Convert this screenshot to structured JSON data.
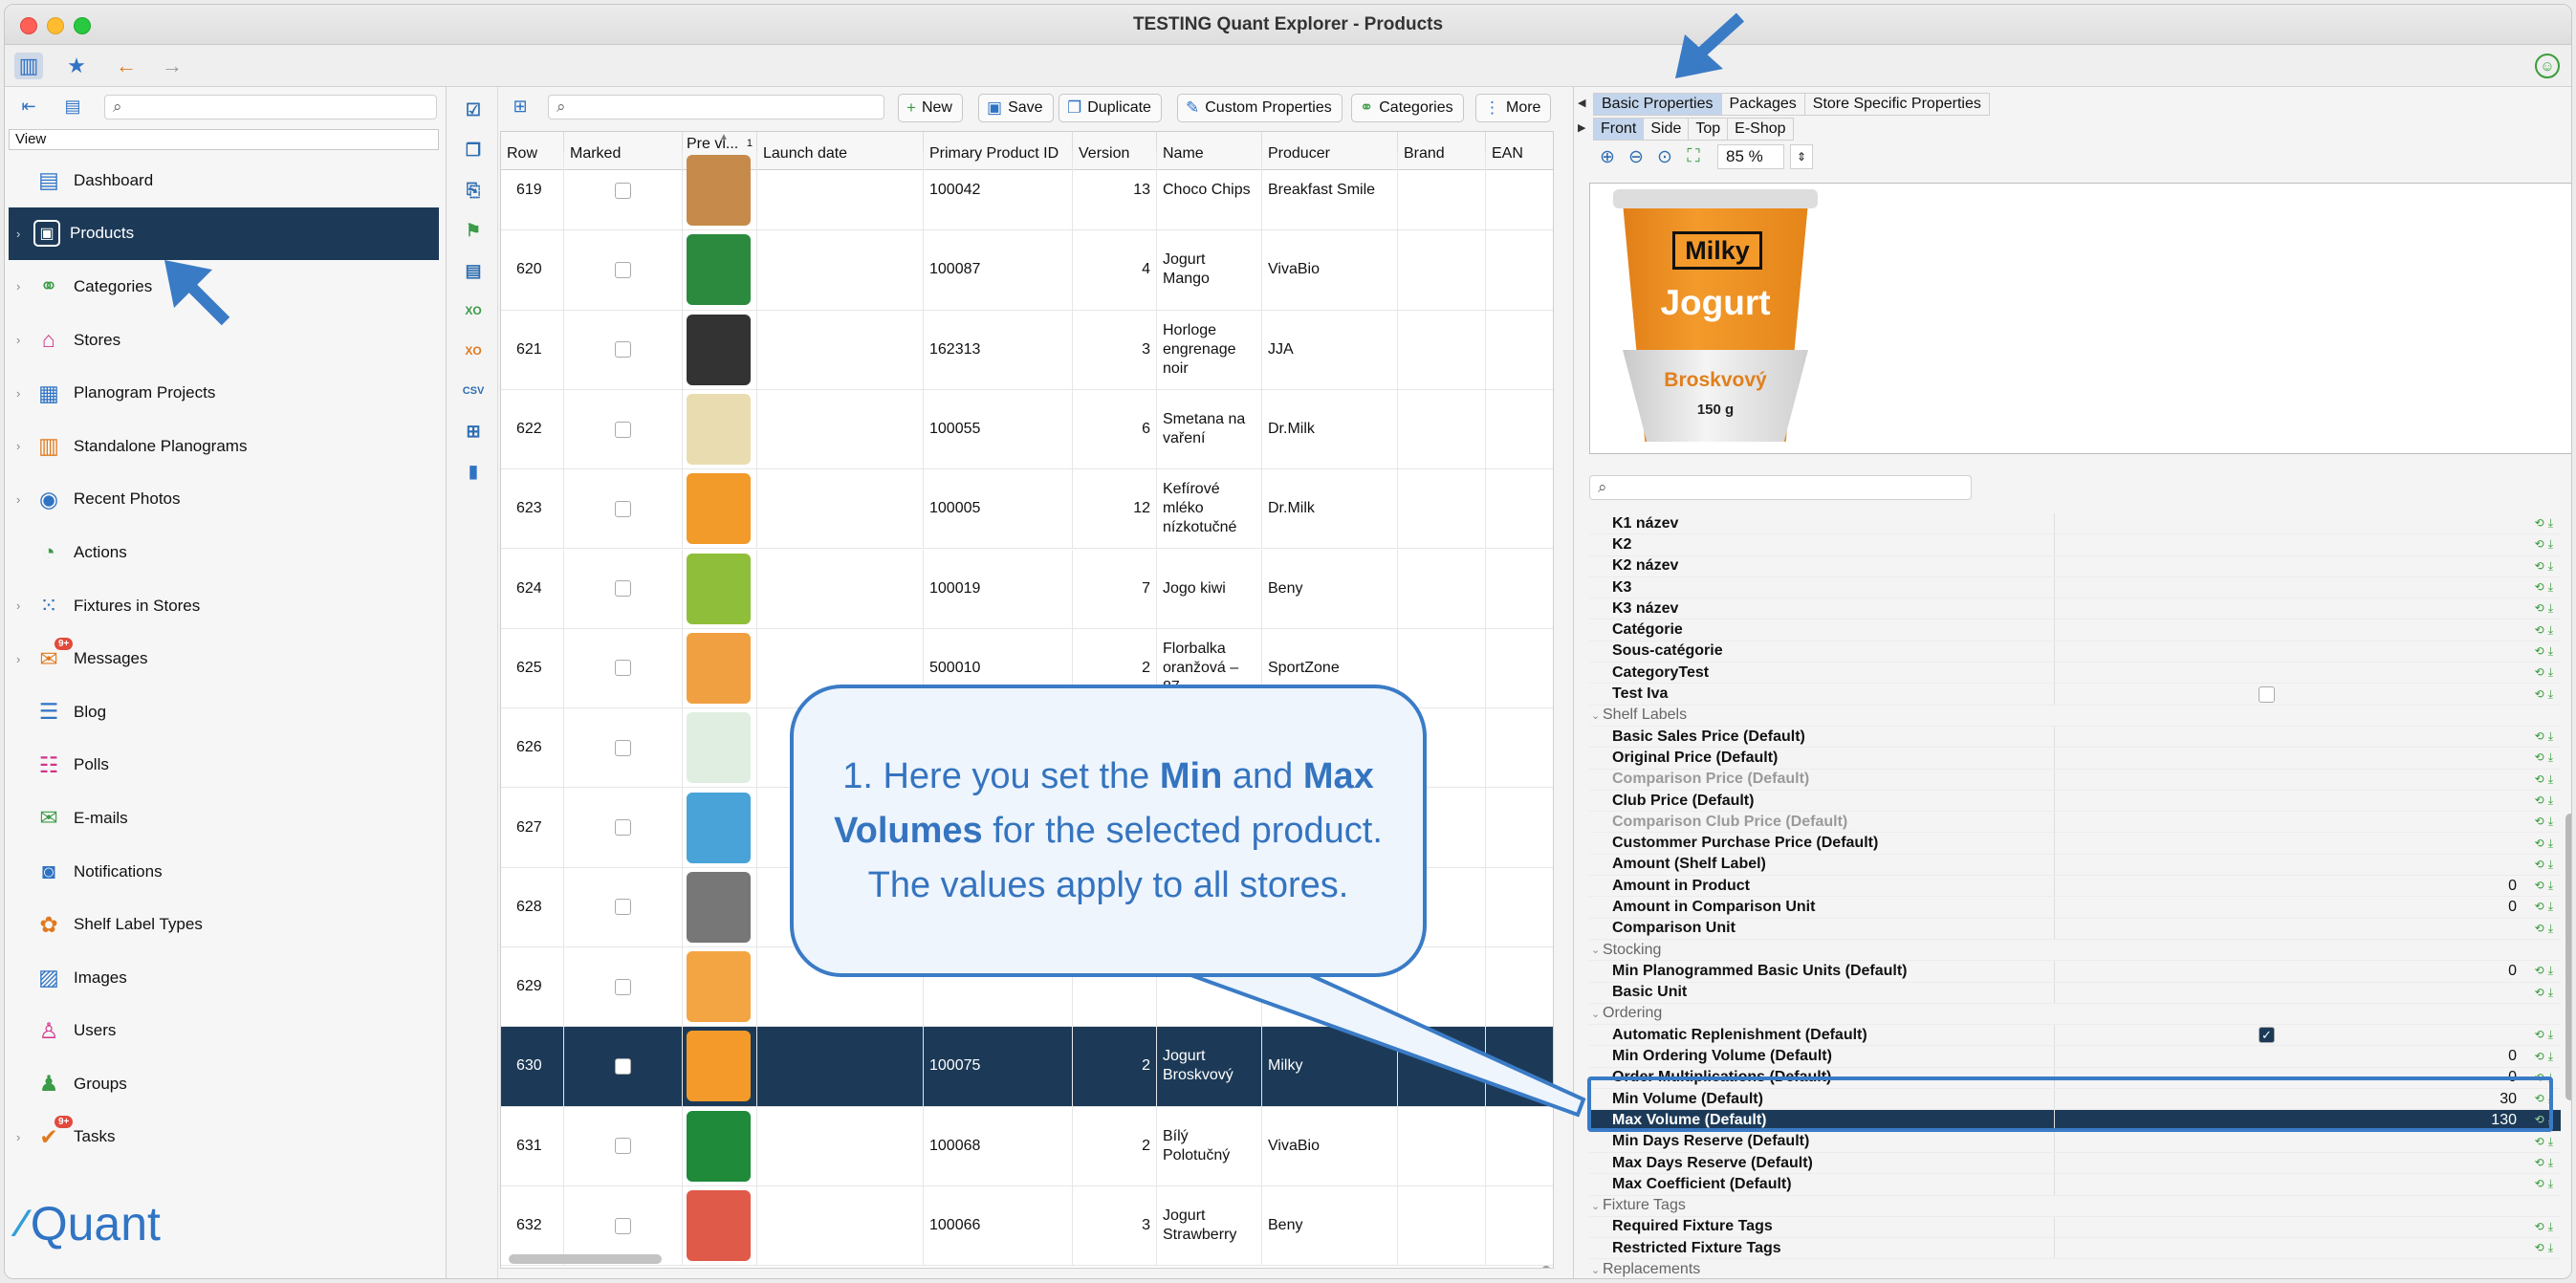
{
  "window": {
    "title": "TESTING Quant Explorer - Products"
  },
  "sidebar": {
    "header": "View",
    "items": [
      {
        "label": "Dashboard",
        "icon": "dashboard-icon",
        "glyph": "▤",
        "color": "#2f73c4",
        "chevron": false
      },
      {
        "label": "Products",
        "icon": "products-icon",
        "glyph": "▣",
        "color": "#ffffff",
        "chevron": true,
        "selected": true
      },
      {
        "label": "Categories",
        "icon": "categories-icon",
        "glyph": "⚭",
        "color": "#3b9b47",
        "chevron": true
      },
      {
        "label": "Stores",
        "icon": "stores-icon",
        "glyph": "⌂",
        "color": "#d2338a",
        "chevron": true
      },
      {
        "label": "Planogram Projects",
        "icon": "planogram-projects-icon",
        "glyph": "▦",
        "color": "#2f73c4",
        "chevron": true
      },
      {
        "label": "Standalone Planograms",
        "icon": "standalone-planograms-icon",
        "glyph": "▥",
        "color": "#e07a1e",
        "chevron": true
      },
      {
        "label": "Recent Photos",
        "icon": "camera-icon",
        "glyph": "◉",
        "color": "#2f73c4",
        "chevron": true
      },
      {
        "label": "Actions",
        "icon": "actions-icon",
        "glyph": "◔",
        "color": "#3b9b47",
        "chevron": false
      },
      {
        "label": "Fixtures in Stores",
        "icon": "fixtures-icon",
        "glyph": "⁙",
        "color": "#2f73c4",
        "chevron": true
      },
      {
        "label": "Messages",
        "icon": "messages-icon",
        "glyph": "✉",
        "color": "#e07a1e",
        "chevron": true,
        "badge": "9+"
      },
      {
        "label": "Blog",
        "icon": "blog-icon",
        "glyph": "☰",
        "color": "#2f73c4",
        "chevron": false
      },
      {
        "label": "Polls",
        "icon": "polls-icon",
        "glyph": "☷",
        "color": "#d2338a",
        "chevron": false
      },
      {
        "label": "E-mails",
        "icon": "email-icon",
        "glyph": "✉",
        "color": "#3b9b47",
        "chevron": false
      },
      {
        "label": "Notifications",
        "icon": "notifications-icon",
        "glyph": "◙",
        "color": "#2f73c4",
        "chevron": false
      },
      {
        "label": "Shelf Label Types",
        "icon": "shelf-label-icon",
        "glyph": "✿",
        "color": "#e07a1e",
        "chevron": false
      },
      {
        "label": "Images",
        "icon": "images-icon",
        "glyph": "▨",
        "color": "#2f73c4",
        "chevron": false
      },
      {
        "label": "Users",
        "icon": "users-icon",
        "glyph": "♙",
        "color": "#d2338a",
        "chevron": false
      },
      {
        "label": "Groups",
        "icon": "groups-icon",
        "glyph": "♟",
        "color": "#3b9b47",
        "chevron": false
      },
      {
        "label": "Tasks",
        "icon": "tasks-icon",
        "glyph": "✔",
        "color": "#e07a1e",
        "chevron": true,
        "badge": "9+"
      }
    ],
    "logo": "Quant"
  },
  "products_toolbar": {
    "new": "New",
    "save": "Save",
    "duplicate": "Duplicate",
    "custom_properties": "Custom Properties",
    "categories": "Categories",
    "more": "More"
  },
  "table": {
    "columns": [
      "Row",
      "Marked",
      "Pre vi...",
      "Launch date",
      "Primary Product ID",
      "Version",
      "Name",
      "Producer",
      "Brand",
      "EAN"
    ],
    "sort_indicator": "1",
    "rows": [
      {
        "row": "619",
        "id": "100042",
        "version": "13",
        "name": "Choco Chips",
        "producer": "Breakfast Smile",
        "thumb": "#c68a4a"
      },
      {
        "row": "620",
        "id": "100087",
        "version": "4",
        "name": "Jogurt Mango",
        "producer": "VivaBio",
        "thumb": "#2c8a3e"
      },
      {
        "row": "621",
        "id": "162313",
        "version": "3",
        "name": "Horloge engrenage noir",
        "producer": "JJA",
        "thumb": "#333333"
      },
      {
        "row": "622",
        "id": "100055",
        "version": "6",
        "name": "Smetana na vaření",
        "producer": "Dr.Milk",
        "thumb": "#e8dcb0"
      },
      {
        "row": "623",
        "id": "100005",
        "version": "12",
        "name": "Kefírové mléko nízkotučné",
        "producer": "Dr.Milk",
        "thumb": "#f29a2a"
      },
      {
        "row": "624",
        "id": "100019",
        "version": "7",
        "name": "Jogo kiwi",
        "producer": "Beny",
        "thumb": "#8fbf3a"
      },
      {
        "row": "625",
        "id": "500010",
        "version": "2",
        "name": "Florbalka oranžová – 87",
        "producer": "SportZone",
        "thumb": "#f0a040"
      },
      {
        "row": "626",
        "id": "",
        "version": "",
        "name": "",
        "producer": "",
        "thumb": "#dfeee0"
      },
      {
        "row": "627",
        "id": "",
        "version": "",
        "name": "",
        "producer": "",
        "thumb": "#4aa3d8"
      },
      {
        "row": "628",
        "id": "",
        "version": "",
        "name": "",
        "producer": "",
        "thumb": "#777777"
      },
      {
        "row": "629",
        "id": "",
        "version": "",
        "name": "",
        "producer": "",
        "thumb": "#f3a443"
      },
      {
        "row": "630",
        "id": "100075",
        "version": "2",
        "name": "Jogurt Broskvový",
        "producer": "Milky",
        "thumb": "#f39a2b",
        "selected": true
      },
      {
        "row": "631",
        "id": "100068",
        "version": "2",
        "name": "Bílý Polotučný",
        "producer": "VivaBio",
        "thumb": "#1f8a3a"
      },
      {
        "row": "632",
        "id": "100066",
        "version": "3",
        "name": "Jogurt Strawberry",
        "producer": "Beny",
        "thumb": "#e05a4a"
      }
    ]
  },
  "right": {
    "tabs": [
      "Basic Properties",
      "Packages",
      "Store Specific Properties"
    ],
    "subtabs": [
      "Front",
      "Side",
      "Top",
      "E-Shop"
    ],
    "zoom": "85 %",
    "preview": {
      "brand": "Milky",
      "name": "Jogurt",
      "flavor": "Broskvový",
      "weight": "150 g"
    },
    "props": [
      {
        "name": "K1 název"
      },
      {
        "name": "K2"
      },
      {
        "name": "K2 název"
      },
      {
        "name": "K3"
      },
      {
        "name": "K3 název"
      },
      {
        "name": "Catégorie"
      },
      {
        "name": "Sous-catégorie"
      },
      {
        "name": "CategoryTest"
      },
      {
        "name": "Test Iva",
        "checkbox": "off"
      },
      {
        "name": "Shelf Labels",
        "group": true
      },
      {
        "name": "Basic Sales Price (Default)"
      },
      {
        "name": "Original Price (Default)"
      },
      {
        "name": "Comparison Price (Default)",
        "disabled": true
      },
      {
        "name": "Club Price (Default)"
      },
      {
        "name": "Comparison Club Price (Default)",
        "disabled": true
      },
      {
        "name": "Custommer Purchase Price (Default)"
      },
      {
        "name": "Amount (Shelf Label)"
      },
      {
        "name": "Amount in Product",
        "value": "0"
      },
      {
        "name": "Amount in Comparison Unit",
        "value": "0"
      },
      {
        "name": "Comparison Unit"
      },
      {
        "name": "Stocking",
        "group": true
      },
      {
        "name": "Min Planogrammed Basic Units (Default)",
        "value": "0"
      },
      {
        "name": "Basic Unit"
      },
      {
        "name": "Ordering",
        "group": true
      },
      {
        "name": "Automatic Replenishment (Default)",
        "checkbox": "on"
      },
      {
        "name": "Min Ordering Volume (Default)",
        "value": "0"
      },
      {
        "name": "Order Multiplications (Default)",
        "value": "0"
      },
      {
        "name": "Min Volume (Default)",
        "value": "30"
      },
      {
        "name": "Max Volume (Default)",
        "value": "130",
        "selected": true
      },
      {
        "name": "Min Days Reserve (Default)"
      },
      {
        "name": "Max Days Reserve (Default)"
      },
      {
        "name": "Max Coefficient (Default)"
      },
      {
        "name": "Fixture Tags",
        "group": true
      },
      {
        "name": "Required Fixture Tags"
      },
      {
        "name": "Restricted Fixture Tags"
      },
      {
        "name": "Replacements",
        "group": true
      }
    ]
  },
  "callout": {
    "part1": "1. Here you set the ",
    "bold1": "Min",
    "part2": " and ",
    "bold2": "Max Volumes",
    "part3": " for the selected product. The values apply to all stores."
  },
  "colors": {
    "accent": "#3a7bc6",
    "selection": "#1c3a57"
  }
}
